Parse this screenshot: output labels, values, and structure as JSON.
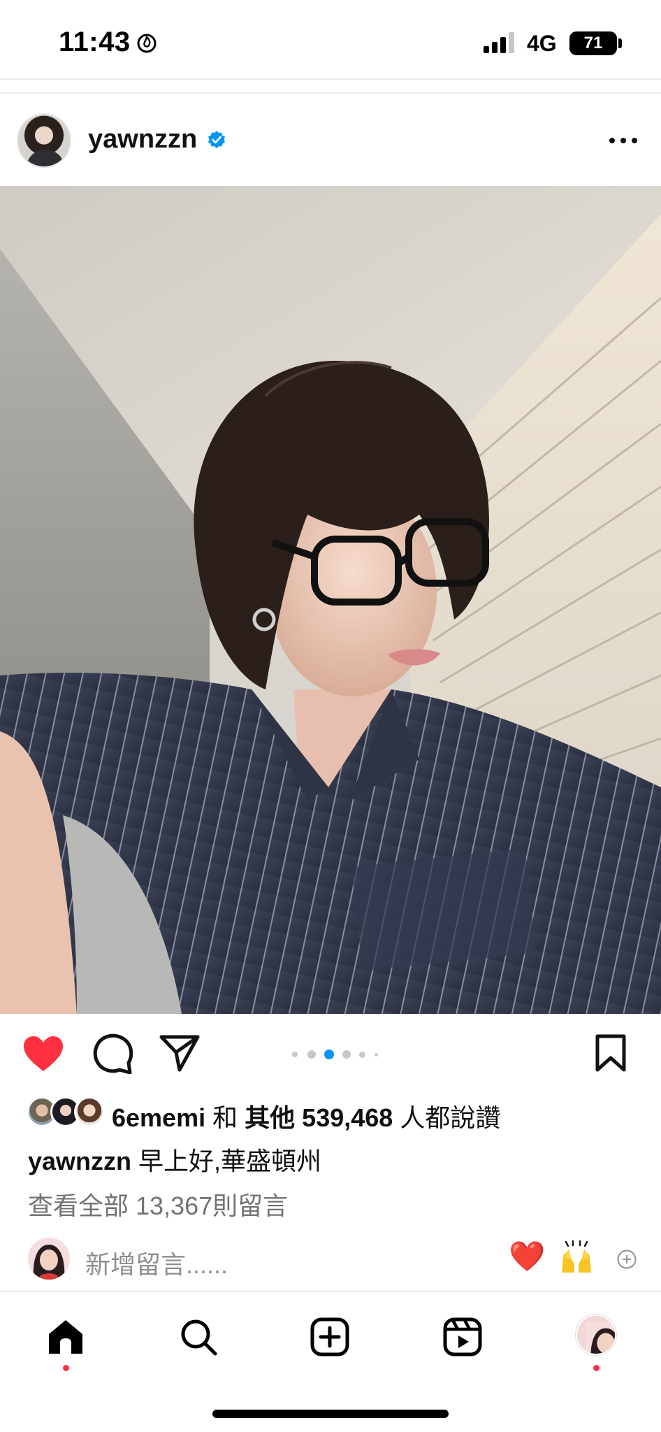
{
  "status_bar": {
    "time": "11:43",
    "network": "4G",
    "battery": "71",
    "icons": [
      "flame-icon",
      "signal-icon",
      "battery-icon"
    ]
  },
  "post": {
    "author": "yawnzzn",
    "verified": true,
    "icons": [
      "verified-badge-icon",
      "more-options-icon"
    ],
    "photo": {
      "carousel_total": 6,
      "carousel_active_index": 2
    }
  },
  "actions": {
    "liked": true,
    "icons": [
      "heart-icon",
      "comment-icon",
      "share-icon",
      "bookmark-icon"
    ],
    "colors": {
      "like": "#ff3040",
      "dot_active": "#0095f6",
      "dot_inactive": "#c7c7c7"
    }
  },
  "likes": {
    "first_liker": "6ememi",
    "connector": "和",
    "others_label": "其他",
    "count": "539,468",
    "suffix": "人都說讚"
  },
  "caption": {
    "username": "yawnzzn",
    "text": "早上好,華盛頓州"
  },
  "comments": {
    "view_all": "查看全部 13,367則留言",
    "placeholder": "新增留言......",
    "quick_reactions": [
      "❤️",
      "🙌"
    ],
    "icons": [
      "add-emoji-icon"
    ]
  },
  "bottom_nav": {
    "items": [
      "home-icon",
      "search-icon",
      "create-post-icon",
      "reels-icon",
      "profile-avatar"
    ],
    "active": "home-icon"
  }
}
